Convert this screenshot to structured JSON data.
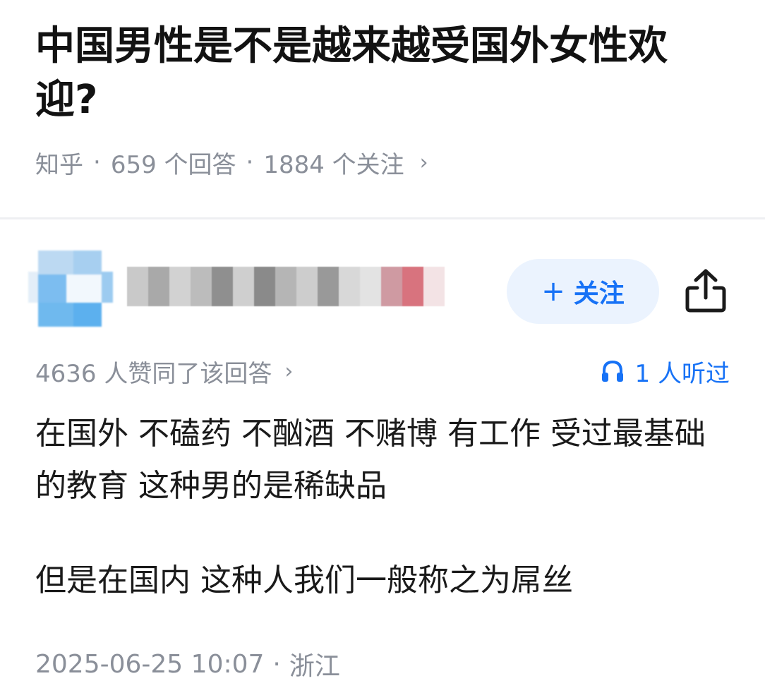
{
  "question": {
    "title": "中国男性是不是越来越受国外女性欢迎?",
    "source": "知乎",
    "separator": "·",
    "answers_count": "659 个回答",
    "followers_count": "1884 个关注",
    "chevron": "›"
  },
  "author": {
    "avatar_icon": "blurred-avatar",
    "follow_label": "关注",
    "follow_plus": "+",
    "share_icon": "share-icon"
  },
  "answer": {
    "votes": "4636 人赞同了该回答",
    "chevron": "›",
    "listen_icon": "headphones-icon",
    "listeners": "1 人听过",
    "paragraphs": [
      "在国外 不磕药 不酗酒 不赌博 有工作 受过最基础的教育 这种男的是稀缺品",
      "但是在国内 这种人我们一般称之为屌丝"
    ],
    "date": "2025-06-25 10:07",
    "separator": "·",
    "location": "浙江"
  },
  "colors": {
    "accent": "#1772f6",
    "muted": "#8a8f99",
    "button_bg": "#ebf3fe"
  }
}
